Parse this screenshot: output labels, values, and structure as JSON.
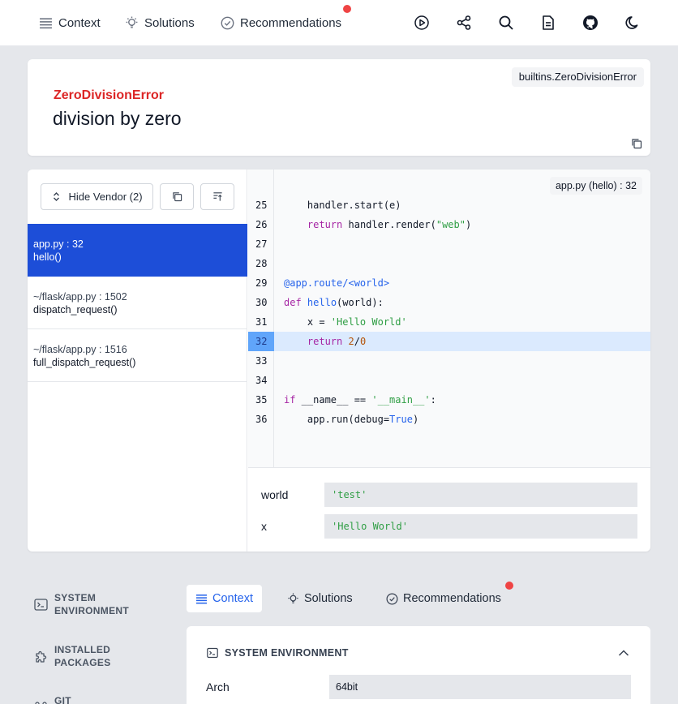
{
  "nav": {
    "tabs": [
      {
        "label": "Context",
        "icon": "list-icon"
      },
      {
        "label": "Solutions",
        "icon": "lightbulb-icon"
      },
      {
        "label": "Recommendations",
        "icon": "check-circle-icon"
      }
    ],
    "notification_color": "#ef4444",
    "actions": [
      "play-icon",
      "share-icon",
      "search-icon",
      "document-icon",
      "github-icon",
      "moon-icon"
    ]
  },
  "error": {
    "type": "ZeroDivisionError",
    "message": "division by zero",
    "class_badge": "builtins.ZeroDivisionError",
    "type_color": "#dc2626"
  },
  "stack": {
    "hide_vendor_label": "Hide Vendor (2)",
    "frames": [
      {
        "location": "app.py : 32",
        "function": "hello()",
        "active": true
      },
      {
        "location": "~/flask/app.py : 1502",
        "function": "dispatch_request()",
        "active": false
      },
      {
        "location": "~/flask/app.py : 1516",
        "function": "full_dispatch_request()",
        "active": false
      }
    ],
    "file_badge": "app.py (hello) : 32",
    "highlight_line": "32",
    "lines": [
      {
        "n": "25",
        "html": "    handler.start(e)"
      },
      {
        "n": "26",
        "html": "    <span class=\"k\">return</span> handler.render(<span class=\"s\">\"web\"</span>)"
      },
      {
        "n": "27",
        "html": ""
      },
      {
        "n": "28",
        "html": ""
      },
      {
        "n": "29",
        "html": "<span class=\"d\">@app.route/&lt;world&gt;</span>"
      },
      {
        "n": "30",
        "html": "<span class=\"k\">def</span> <span class=\"d\">hello</span>(world):"
      },
      {
        "n": "31",
        "html": "    x = <span class=\"s\">'Hello World'</span>"
      },
      {
        "n": "32",
        "html": "    <span class=\"k\">return</span> <span class=\"n\">2</span>/<span class=\"n\">0</span>"
      },
      {
        "n": "33",
        "html": ""
      },
      {
        "n": "34",
        "html": ""
      },
      {
        "n": "35",
        "html": "<span class=\"k\">if</span> __name__ == <span class=\"s\">'__main__'</span>:"
      },
      {
        "n": "36",
        "html": "    app.run(debug=<span class=\"d\">True</span>)"
      }
    ],
    "variables": [
      {
        "name": "world",
        "value": "'test'"
      },
      {
        "name": "x",
        "value": "'Hello World'"
      }
    ]
  },
  "sidebar": {
    "items": [
      {
        "label_1": "SYSTEM",
        "label_2": "ENVIRONMENT"
      },
      {
        "label_1": "INSTALLED",
        "label_2": "PACKAGES"
      },
      {
        "label_1": "GIT",
        "label_2": ""
      }
    ]
  },
  "bottom_tabs": [
    {
      "label": "Context",
      "active": true
    },
    {
      "label": "Solutions",
      "active": false
    },
    {
      "label": "Recommendations",
      "active": false
    }
  ],
  "context": {
    "section_title": "SYSTEM ENVIRONMENT",
    "rows": [
      {
        "key": "Arch",
        "value": "64bit"
      }
    ]
  }
}
